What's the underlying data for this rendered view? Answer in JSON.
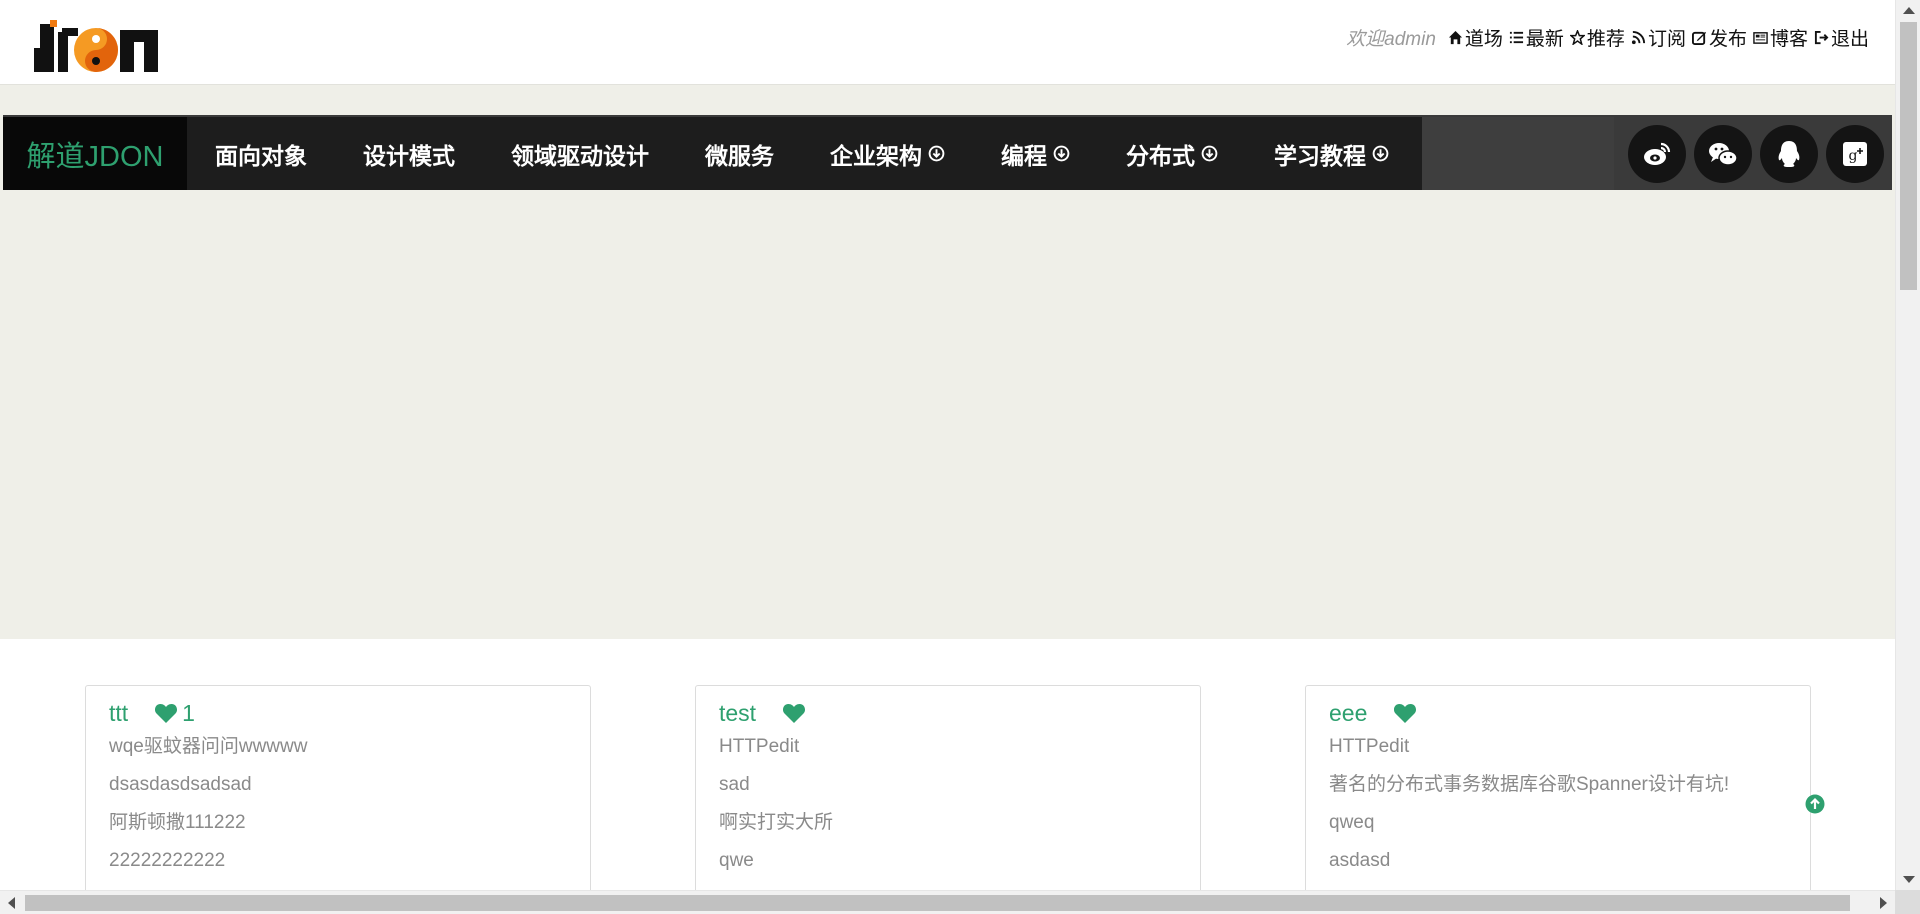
{
  "logo": {
    "icon": "jdon-logo"
  },
  "topnav": {
    "welcome": "欢迎admin",
    "items": [
      {
        "label": "道场",
        "icon": "home-icon"
      },
      {
        "label": "最新",
        "icon": "list-icon"
      },
      {
        "label": "推荐",
        "icon": "star-icon"
      },
      {
        "label": "订阅",
        "icon": "rss-icon"
      },
      {
        "label": "发布",
        "icon": "edit-icon"
      },
      {
        "label": "博客",
        "icon": "newspaper-icon"
      },
      {
        "label": "退出",
        "icon": "logout-icon"
      }
    ]
  },
  "mainnav": {
    "brand": "解道JDON",
    "items": [
      {
        "label": "面向对象",
        "dropdown": false
      },
      {
        "label": "设计模式",
        "dropdown": false
      },
      {
        "label": "领域驱动设计",
        "dropdown": false
      },
      {
        "label": "微服务",
        "dropdown": false
      },
      {
        "label": "企业架构",
        "dropdown": true
      },
      {
        "label": "编程",
        "dropdown": true
      },
      {
        "label": "分布式",
        "dropdown": true
      },
      {
        "label": "学习教程",
        "dropdown": true
      }
    ],
    "social": [
      "weibo-icon",
      "wechat-icon",
      "qq-icon",
      "google-plus-icon"
    ]
  },
  "cards": [
    {
      "name": "ttt",
      "likes": "1",
      "lines": [
        "wqe驱蚊器问问wwwww",
        "dsasdasdsadsad",
        "阿斯顿撒111222",
        "22222222222"
      ]
    },
    {
      "name": "test",
      "likes": "",
      "lines": [
        "HTTPedit",
        "sad",
        "啊实打实大所",
        "qwe"
      ]
    },
    {
      "name": "eee",
      "likes": "",
      "lines": [
        "HTTPedit",
        "著名的分布式事务数据库谷歌Spanner设计有坑!",
        "qweq",
        "asdasd"
      ]
    }
  ],
  "colors": {
    "accent": "#2ea06f",
    "nav_bg": "#1d1d1d",
    "band_bg": "#efefe8"
  }
}
